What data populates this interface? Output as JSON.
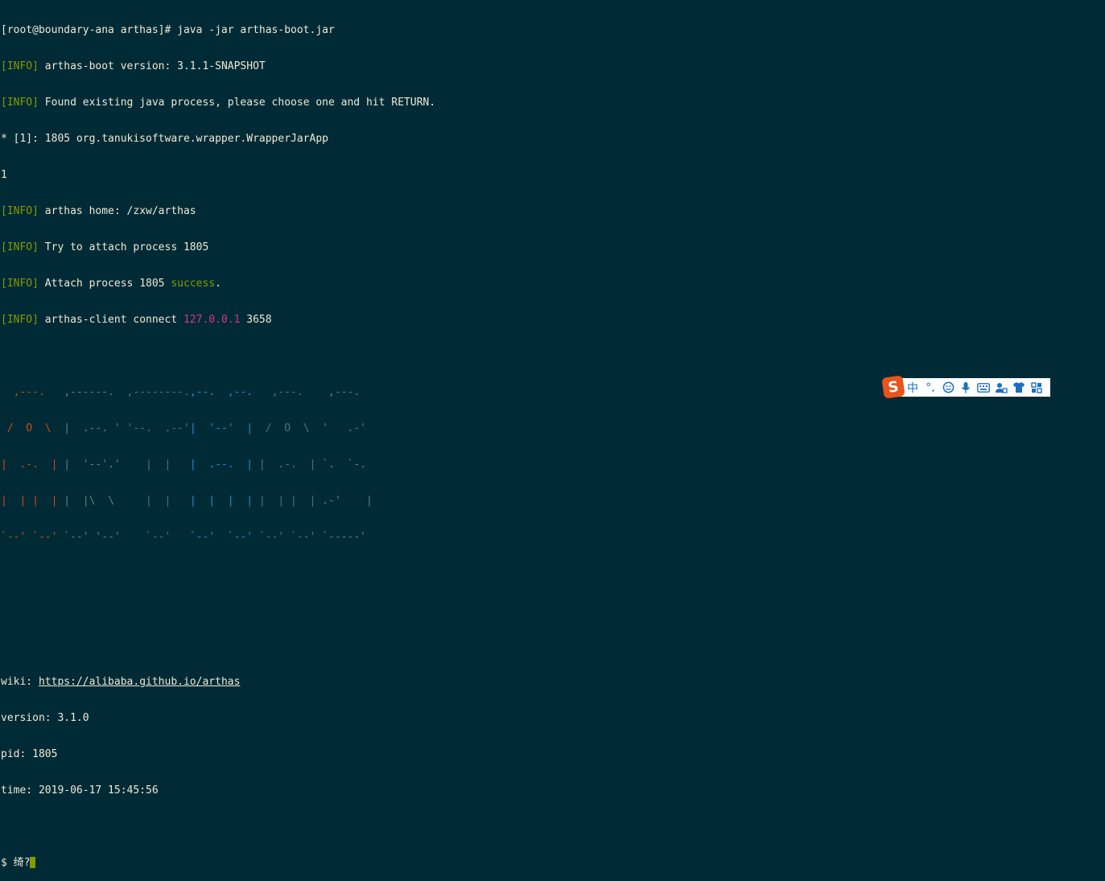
{
  "terminal": {
    "prompt_line": "[root@boundary-ana arthas]# java -jar arthas-boot.jar",
    "info_tag": "[INFO]",
    "boot_version": " arthas-boot version: 3.1.1-SNAPSHOT",
    "found_process": " Found existing java process, please choose one and hit RETURN.",
    "process_option": "* [1]: 1805 org.tanukisoftware.wrapper.WrapperJarApp",
    "user_choice": "1",
    "home": " arthas home: /zxw/arthas",
    "try_attach": " Try to attach process 1805",
    "attach_prefix": " Attach process 1805 ",
    "attach_success": "success",
    "attach_suffix": ".",
    "connect_prefix": " arthas-client connect ",
    "connect_ip": "127.0.0.1",
    "connect_port": " 3658",
    "logo": {
      "a": [
        "  ,---.  ",
        " /  O  \\ ",
        "|  .-.  |",
        "|  | |  |",
        "`--' `--'"
      ],
      "r": [
        " ,------. ",
        " |  .--. '",
        " |  '--'.'",
        " |  |\\  \\ ",
        " `--' '--'"
      ],
      "t": [
        " ,--------.",
        " '--.  .--'",
        "    |  |   ",
        "    |  |   ",
        "    `--'   "
      ],
      "h": [
        ",--.  ,--. ",
        "|  '--'  | ",
        "|  .--.  | ",
        "|  |  |  | ",
        "`--'  `--' "
      ],
      "a2": [
        "  ,---.  ",
        " /  O  \\ ",
        "|  .-.  |",
        "|  | |  |",
        "`--' `--'"
      ],
      "s": [
        "  ,---.  ",
        " '   .-' ",
        " `.  `-. ",
        " .-'    |",
        " `-----' "
      ]
    },
    "wiki_label": "wiki: ",
    "wiki_url": "https://alibaba.github.io/arthas",
    "version": "version: 3.1.0",
    "pid": "pid: 1805",
    "time": "time: 2019-06-17 15:45:56",
    "shell_prompt": "$ 绮?"
  },
  "ime_toolbar": {
    "logo_letter": "S",
    "mode_label": "中",
    "punct_label": "°,",
    "icons": [
      "emoji-icon",
      "microphone-icon",
      "keyboard-icon",
      "user-tools-icon",
      "skin-shirt-icon",
      "grid-apps-icon"
    ],
    "accent_color": "#1a6fc2",
    "logo_color": "#e8541e"
  },
  "colors": {
    "background": "#002b36",
    "text": "#eee8d5",
    "info": "#859900",
    "ip": "#d33682"
  }
}
